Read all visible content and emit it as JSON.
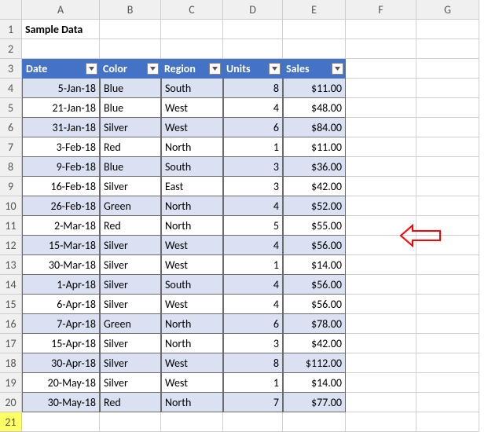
{
  "columns": [
    "A",
    "B",
    "C",
    "D",
    "E",
    "F",
    "G"
  ],
  "title_cell": "Sample Data",
  "headers": {
    "date": "Date",
    "color": "Color",
    "region": "Region",
    "units": "Units",
    "sales": "Sales"
  },
  "rows": [
    {
      "n": 4,
      "date": "5-Jan-18",
      "color": "Blue",
      "region": "South",
      "units": "8",
      "sales": "$11.00"
    },
    {
      "n": 5,
      "date": "21-Jan-18",
      "color": "Blue",
      "region": "West",
      "units": "4",
      "sales": "$48.00"
    },
    {
      "n": 6,
      "date": "31-Jan-18",
      "color": "Silver",
      "region": "West",
      "units": "6",
      "sales": "$84.00"
    },
    {
      "n": 7,
      "date": "3-Feb-18",
      "color": "Red",
      "region": "North",
      "units": "1",
      "sales": "$11.00"
    },
    {
      "n": 8,
      "date": "9-Feb-18",
      "color": "Blue",
      "region": "South",
      "units": "3",
      "sales": "$36.00"
    },
    {
      "n": 9,
      "date": "16-Feb-18",
      "color": "Silver",
      "region": "East",
      "units": "3",
      "sales": "$42.00"
    },
    {
      "n": 10,
      "date": "26-Feb-18",
      "color": "Green",
      "region": "North",
      "units": "4",
      "sales": "$52.00"
    },
    {
      "n": 11,
      "date": "2-Mar-18",
      "color": "Red",
      "region": "North",
      "units": "5",
      "sales": "$55.00"
    },
    {
      "n": 12,
      "date": "15-Mar-18",
      "color": "Silver",
      "region": "West",
      "units": "4",
      "sales": "$56.00"
    },
    {
      "n": 13,
      "date": "30-Mar-18",
      "color": "Silver",
      "region": "West",
      "units": "1",
      "sales": "$14.00"
    },
    {
      "n": 14,
      "date": "1-Apr-18",
      "color": "Silver",
      "region": "South",
      "units": "4",
      "sales": "$56.00"
    },
    {
      "n": 15,
      "date": "6-Apr-18",
      "color": "Silver",
      "region": "West",
      "units": "4",
      "sales": "$56.00"
    },
    {
      "n": 16,
      "date": "7-Apr-18",
      "color": "Green",
      "region": "North",
      "units": "6",
      "sales": "$78.00"
    },
    {
      "n": 17,
      "date": "15-Apr-18",
      "color": "Silver",
      "region": "North",
      "units": "3",
      "sales": "$42.00"
    },
    {
      "n": 18,
      "date": "30-Apr-18",
      "color": "Silver",
      "region": "West",
      "units": "8",
      "sales": "$112.00"
    },
    {
      "n": 19,
      "date": "20-May-18",
      "color": "Silver",
      "region": "West",
      "units": "1",
      "sales": "$14.00"
    },
    {
      "n": 20,
      "date": "30-May-18",
      "color": "Red",
      "region": "North",
      "units": "7",
      "sales": "$77.00"
    }
  ],
  "empty_row": 21,
  "arrow_color": "#ff0000"
}
